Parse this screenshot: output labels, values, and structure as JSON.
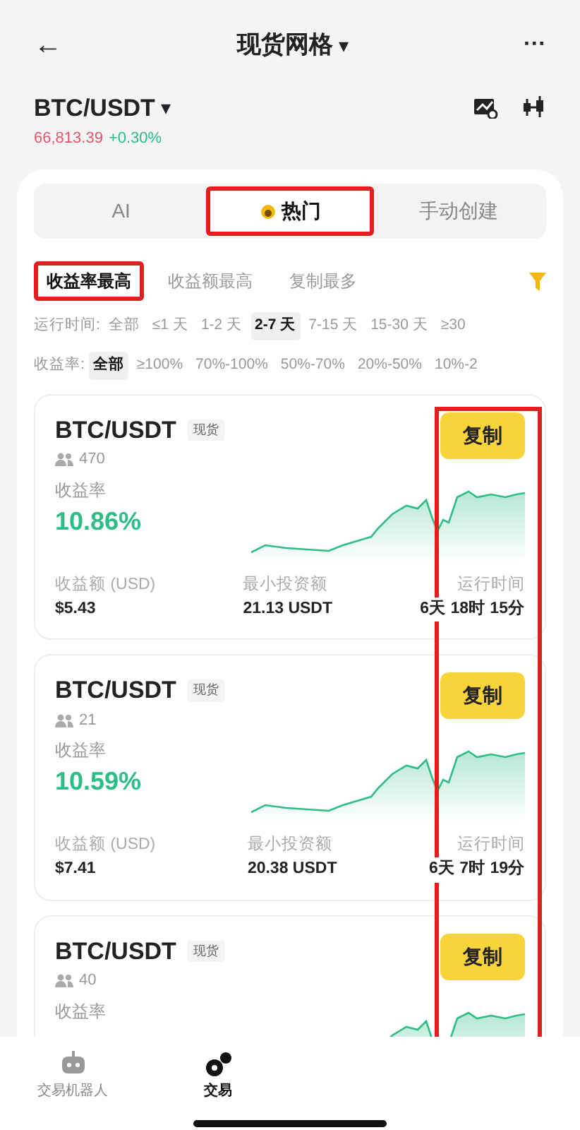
{
  "header": {
    "back": "←",
    "title": "现货网格",
    "caret": "▾",
    "more": "···"
  },
  "pair": {
    "name": "BTC/USDT",
    "caret": "▾",
    "price": "66,813.39",
    "change": "+0.30%"
  },
  "tabs": [
    {
      "label": "AI",
      "selected": false,
      "highlighted": false
    },
    {
      "label": "热门",
      "selected": true,
      "highlighted": true
    },
    {
      "label": "手动创建",
      "selected": false,
      "highlighted": false
    }
  ],
  "sorts": [
    {
      "label": "收益率最高",
      "selected": true,
      "highlighted": true
    },
    {
      "label": "收益额最高",
      "selected": false,
      "highlighted": false
    },
    {
      "label": "复制最多",
      "selected": false,
      "highlighted": false
    }
  ],
  "filters": [
    {
      "label": "运行时间:",
      "options": [
        {
          "label": "全部",
          "selected": false
        },
        {
          "label": "≤1 天",
          "selected": false
        },
        {
          "label": "1-2 天",
          "selected": false
        },
        {
          "label": "2-7 天",
          "selected": true
        },
        {
          "label": "7-15 天",
          "selected": false
        },
        {
          "label": "15-30 天",
          "selected": false
        },
        {
          "label": "≥30",
          "selected": false
        }
      ]
    },
    {
      "label": "收益率:",
      "options": [
        {
          "label": "全部",
          "selected": true
        },
        {
          "label": "≥100%",
          "selected": false
        },
        {
          "label": "70%-100%",
          "selected": false
        },
        {
          "label": "50%-70%",
          "selected": false
        },
        {
          "label": "20%-50%",
          "selected": false
        },
        {
          "label": "10%-2",
          "selected": false
        }
      ]
    }
  ],
  "copy_column_highlighted": true,
  "cards": [
    {
      "pair": "BTC/USDT",
      "tag": "现货",
      "followers": "470",
      "button": "复制",
      "yield_label": "收益率",
      "yield": "10.86%",
      "stats": [
        {
          "label": "收益额 (USD)",
          "value": "$5.43"
        },
        {
          "label": "最小投资额",
          "value": "21.13 USDT"
        },
        {
          "label": "运行时间",
          "value": "6天 18时 15分"
        }
      ]
    },
    {
      "pair": "BTC/USDT",
      "tag": "现货",
      "followers": "21",
      "button": "复制",
      "yield_label": "收益率",
      "yield": "10.59%",
      "stats": [
        {
          "label": "收益额 (USD)",
          "value": "$7.41"
        },
        {
          "label": "最小投资额",
          "value": "20.38 USDT"
        },
        {
          "label": "运行时间",
          "value": "6天 7时 19分"
        }
      ]
    },
    {
      "pair": "BTC/USDT",
      "tag": "现货",
      "followers": "40",
      "button": "复制",
      "yield_label": "收益率"
    }
  ],
  "bottom_nav": [
    {
      "label": "交易机器人",
      "selected": false,
      "kind": "robot"
    },
    {
      "label": "交易",
      "selected": true,
      "kind": "trade"
    }
  ]
}
